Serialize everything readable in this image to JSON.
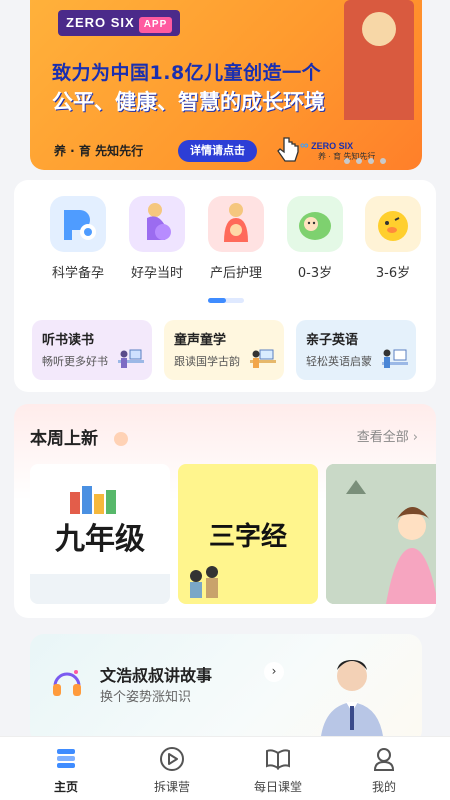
{
  "banner": {
    "brand": "ZERO SIX",
    "brand_badge": "APP",
    "headline_line1": "致力为中国1.8亿儿童创造一个",
    "headline_line2": "公平、健康、智慧的成长环境",
    "slogan": "养 · 育 先知先行",
    "cta": "详情请点击",
    "mini_logo_name": "ZERO SIX",
    "mini_logo_slogan": "养 · 育 先知先行"
  },
  "categories": [
    {
      "label": "科学备孕",
      "icon": "science-prep-icon",
      "color": "#e3efff"
    },
    {
      "label": "好孕当时",
      "icon": "pregnant-icon",
      "color": "#efe4ff"
    },
    {
      "label": "产后护理",
      "icon": "postpartum-icon",
      "color": "#ffe2e2"
    },
    {
      "label": "0-3岁",
      "icon": "baby-icon",
      "color": "#e4f9e6"
    },
    {
      "label": "3-6岁",
      "icon": "duck-icon",
      "color": "#fff3d6"
    }
  ],
  "features": [
    {
      "title": "听书读书",
      "subtitle": "畅听更多好书",
      "color": "#f3e9fb"
    },
    {
      "title": "童声童学",
      "subtitle": "跟读国学古韵",
      "color": "#fff7df"
    },
    {
      "title": "亲子英语",
      "subtitle": "轻松英语启蒙",
      "color": "#e5f1fb"
    }
  ],
  "weekly": {
    "title": "本周上新",
    "see_all": "查看全部",
    "covers": [
      {
        "text": "九年级",
        "bg": "#ffffff",
        "color": "#1b1b1b"
      },
      {
        "text": "三字经",
        "bg": "#fff58d",
        "color": "#111111"
      },
      {
        "text": "",
        "bg": "#c9d9c7",
        "color": "#333333"
      }
    ]
  },
  "story": {
    "title": "文浩叔叔讲故事",
    "subtitle": "换个姿势涨知识"
  },
  "nav": [
    {
      "label": "主页",
      "icon": "home-icon",
      "active": true
    },
    {
      "label": "拆课营",
      "icon": "play-icon",
      "active": false
    },
    {
      "label": "每日课堂",
      "icon": "book-icon",
      "active": false
    },
    {
      "label": "我的",
      "icon": "profile-icon",
      "active": false
    }
  ],
  "colors": {
    "accent": "#3f8cff",
    "banner_orange": "#ff9a2e",
    "banner_blue": "#1a2fb0"
  }
}
